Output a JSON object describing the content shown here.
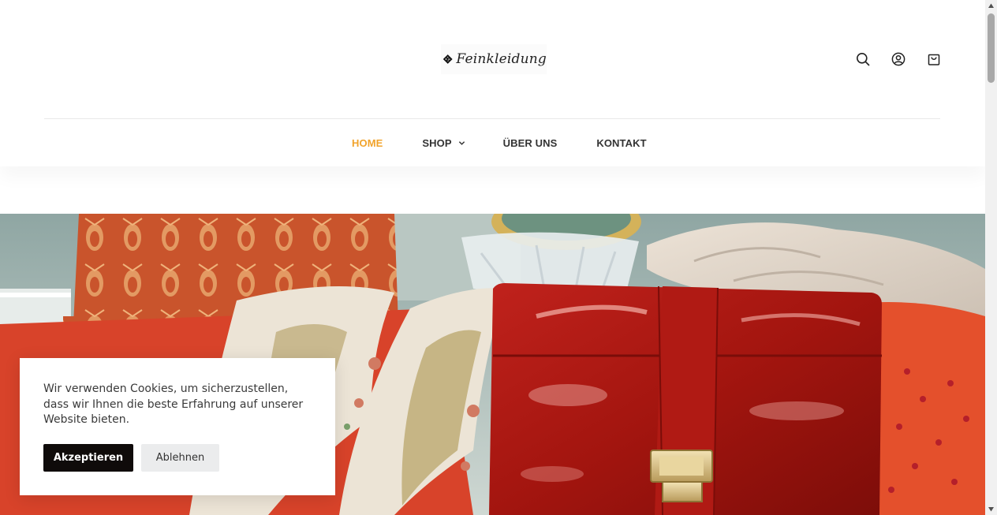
{
  "brand": {
    "name": "Feinkleidung"
  },
  "header": {
    "icons": [
      "search-icon",
      "account-icon",
      "cart-icon"
    ]
  },
  "nav": {
    "items": [
      {
        "label": "HOME",
        "active": true
      },
      {
        "label": "SHOP",
        "has_dropdown": true
      },
      {
        "label": "ÜBER UNS"
      },
      {
        "label": "KONTAKT"
      }
    ],
    "active_color": "#f1a32b"
  },
  "cookie_banner": {
    "text": "Wir verwenden Cookies, um sicherzustellen, dass wir Ihnen die beste Erfahrung auf unserer Website bieten.",
    "accept_label": "Akzeptieren",
    "decline_label": "Ablehnen"
  },
  "colors": {
    "accent": "#f1a32b",
    "accept_button": "#0f0b0a",
    "decline_button": "#ebeced"
  }
}
